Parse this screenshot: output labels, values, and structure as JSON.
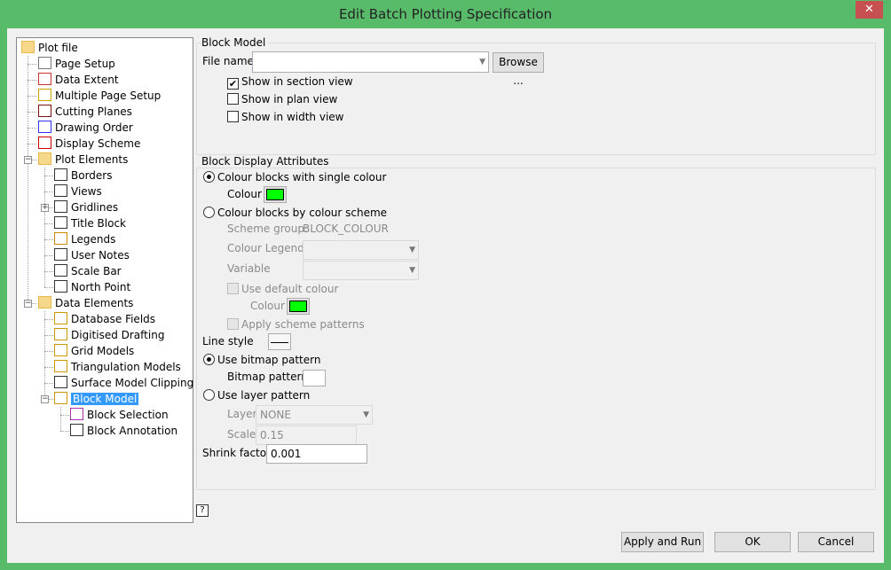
{
  "window": {
    "title": "Edit Batch Plotting Specification",
    "close": "✕"
  },
  "tree": [
    {
      "label": "Plot file",
      "icon": "folder-icon"
    },
    {
      "label": "Page Setup",
      "icon": "page-setup-icon"
    },
    {
      "label": "Data Extent",
      "icon": "data-extent-icon"
    },
    {
      "label": "Multiple Page Setup",
      "icon": "multiple-page-icon"
    },
    {
      "label": "Cutting Planes",
      "icon": "cube-icon"
    },
    {
      "label": "Drawing Order",
      "icon": "drawing-order-icon"
    },
    {
      "label": "Display Scheme",
      "icon": "display-scheme-icon"
    },
    {
      "label": "Plot Elements",
      "icon": "folder-icon"
    },
    {
      "label": "Borders",
      "icon": "border-icon"
    },
    {
      "label": "Views",
      "icon": "views-icon"
    },
    {
      "label": "Gridlines",
      "icon": "grid-icon"
    },
    {
      "label": "Title Block",
      "icon": "title-block-icon"
    },
    {
      "label": "Legends",
      "icon": "legend-icon"
    },
    {
      "label": "User Notes",
      "icon": "note-icon"
    },
    {
      "label": "Scale Bar",
      "icon": "scale-bar-icon"
    },
    {
      "label": "North Point",
      "icon": "north-point-icon"
    },
    {
      "label": "Data Elements",
      "icon": "folder-icon"
    },
    {
      "label": "Database Fields",
      "icon": "database-icon"
    },
    {
      "label": "Digitised Drafting",
      "icon": "drafting-icon"
    },
    {
      "label": "Grid Models",
      "icon": "grid-model-icon"
    },
    {
      "label": "Triangulation Models",
      "icon": "triangulation-icon"
    },
    {
      "label": "Surface Model Clipping",
      "icon": "clipping-icon"
    },
    {
      "label": "Block Model",
      "icon": "block-model-icon"
    },
    {
      "label": "Block Selection",
      "icon": "block-selection-icon"
    },
    {
      "label": "Block Annotation",
      "icon": "block-annotation-icon"
    }
  ],
  "block_model": {
    "group": "Block Model",
    "file_label": "File name",
    "file_value": "",
    "browse": "Browse ...",
    "section": "Show in section view",
    "plan": "Show in plan view",
    "width": "Show in width view"
  },
  "attrs": {
    "group": "Block Display Attributes",
    "single": "Colour blocks with single colour",
    "colour": "Colour",
    "scheme": "Colour blocks by colour scheme",
    "scheme_group_label": "Scheme group:",
    "scheme_group": "BLOCK_COLOUR",
    "legend": "Colour Legend",
    "variable": "Variable",
    "use_default": "Use default colour",
    "apply_patterns": "Apply scheme patterns",
    "line_style": "Line style",
    "bitmap": "Use bitmap pattern",
    "bitmap_label": "Bitmap pattern",
    "layer_pattern": "Use layer pattern",
    "layer": "Layer",
    "layer_value": "NONE",
    "scale": "Scale",
    "scale_value": "0.15",
    "shrink": "Shrink factor",
    "shrink_value": "0.001",
    "colour_hex": "#00ff00"
  },
  "help": "?",
  "buttons": {
    "apply_run": "Apply and Run",
    "ok": "OK",
    "cancel": "Cancel"
  }
}
